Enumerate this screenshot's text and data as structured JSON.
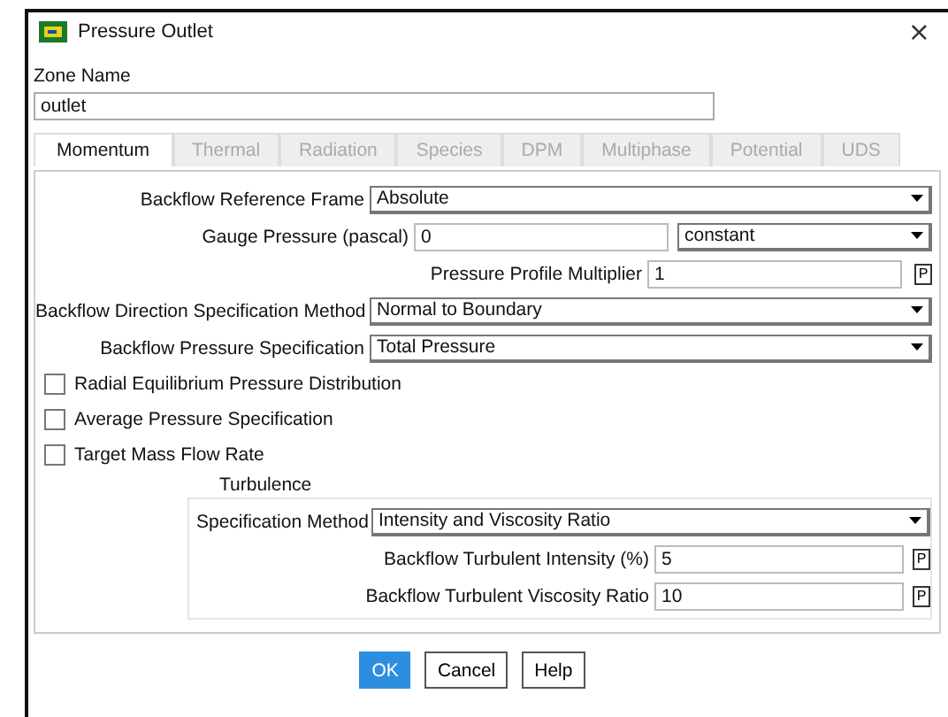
{
  "window": {
    "title": "Pressure Outlet",
    "close": "×"
  },
  "zone": {
    "label": "Zone Name",
    "value": "outlet"
  },
  "tabs": [
    {
      "label": "Momentum",
      "selected": true,
      "disabled": false
    },
    {
      "label": "Thermal",
      "selected": false,
      "disabled": true
    },
    {
      "label": "Radiation",
      "selected": false,
      "disabled": true
    },
    {
      "label": "Species",
      "selected": false,
      "disabled": true
    },
    {
      "label": "DPM",
      "selected": false,
      "disabled": true
    },
    {
      "label": "Multiphase",
      "selected": false,
      "disabled": true
    },
    {
      "label": "Potential",
      "selected": false,
      "disabled": true
    },
    {
      "label": "UDS",
      "selected": false,
      "disabled": true
    }
  ],
  "rows": [
    {
      "kind": "dropdown",
      "label": "Backflow Reference Frame",
      "value": "Absolute"
    },
    {
      "kind": "input_dropdown",
      "label": "Gauge Pressure (pascal)",
      "value": "0",
      "option": "constant"
    },
    {
      "kind": "input_p",
      "label": "Pressure Profile Multiplier",
      "value": "1",
      "p": "P"
    },
    {
      "kind": "dropdown",
      "label": "Backflow Direction Specification Method",
      "value": "Normal to Boundary"
    },
    {
      "kind": "dropdown",
      "label": "Backflow Pressure Specification",
      "value": "Total Pressure"
    }
  ],
  "checkboxes": [
    {
      "label": "Radial Equilibrium Pressure Distribution",
      "checked": false
    },
    {
      "label": "Average Pressure Specification",
      "checked": false
    },
    {
      "label": "Target Mass Flow Rate",
      "checked": false
    }
  ],
  "turbulence": {
    "title": "Turbulence",
    "rows": [
      {
        "kind": "dropdown",
        "label": "Specification Method",
        "value": "Intensity and Viscosity Ratio"
      },
      {
        "kind": "input_p",
        "label": "Backflow Turbulent Intensity (%)",
        "value": "5",
        "p": "P"
      },
      {
        "kind": "input_p",
        "label": "Backflow Turbulent Viscosity Ratio",
        "value": "10",
        "p": "P"
      }
    ]
  },
  "buttons": [
    {
      "label": "OK",
      "kind": "primary"
    },
    {
      "label": "Cancel",
      "kind": "normal"
    },
    {
      "label": "Help",
      "kind": "normal"
    }
  ]
}
